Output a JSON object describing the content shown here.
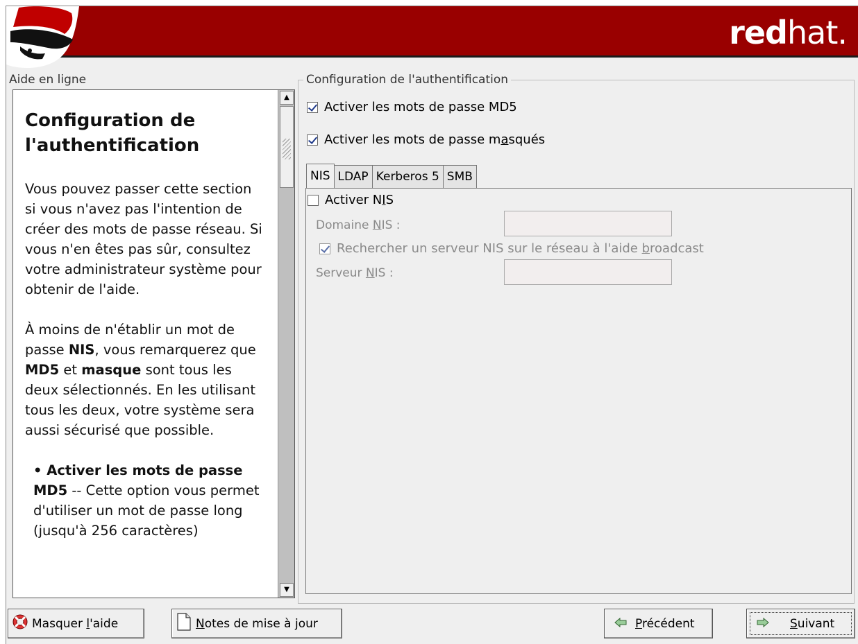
{
  "header": {
    "brand_bold": "red",
    "brand_light": "hat."
  },
  "help": {
    "label": "Aide en ligne",
    "title": "Configuration de l'authentification",
    "para1": "Vous pouvez passer cette section si vous n'avez pas l'intention de créer des mots de passe réseau. Si vous n'en êtes pas sûr, consultez votre administrateur système pour obtenir de l'aide.",
    "para2_a": "À moins de n'établir un mot de passe ",
    "para2_b": "NIS",
    "para2_c": ", vous remarquerez que ",
    "para2_d": "MD5",
    "para2_e": " et ",
    "para2_f": "masque",
    "para2_g": " sont tous les deux sélectionnés. En les utilisant tous les deux, votre système sera aussi sécurisé que possible.",
    "bullet_bold": "• Activer les mots de passe MD5",
    "bullet_text": " -- Cette option vous permet d'utiliser un mot de passe long (jusqu'à 256 caractères)"
  },
  "config": {
    "legend": "Configuration de l'authentification",
    "md5_label": "Activer les mots de passe MD5",
    "md5_checked": true,
    "shadow_label_a": "Activer les mots de passe m",
    "shadow_label_u": "a",
    "shadow_label_b": "squés",
    "shadow_checked": true,
    "tabs": [
      "NIS",
      "LDAP",
      "Kerberos 5",
      "SMB"
    ],
    "active_tab": "NIS",
    "nis": {
      "enable_a": "Activer N",
      "enable_u": "I",
      "enable_b": "S",
      "enable_checked": false,
      "domain_a": "Domaine ",
      "domain_u": "N",
      "domain_b": "IS :",
      "domain_value": "",
      "broadcast_a": "Rechercher un serveur NIS sur le réseau à l'aide ",
      "broadcast_u": "b",
      "broadcast_b": "roadcast",
      "broadcast_checked": true,
      "server_a": "Serveur ",
      "server_u": "N",
      "server_b": "IS :",
      "server_value": ""
    }
  },
  "buttons": {
    "hide_help_a": "Masquer ",
    "hide_help_u": "l",
    "hide_help_b": "'aide",
    "release_notes_u": "N",
    "release_notes_b": "otes de mise à jour",
    "back_u": "P",
    "back_b": "récédent",
    "next_u": "S",
    "next_b": "uivant"
  },
  "colors": {
    "banner": "#990000",
    "window_bg": "#efefef"
  }
}
